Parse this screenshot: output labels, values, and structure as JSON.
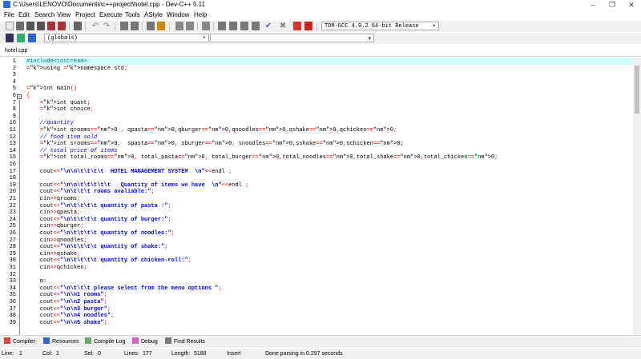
{
  "window": {
    "title": "C:\\Users\\LENOVO\\Documents\\c++project\\hotel.cpp - Dev-C++ 5.11",
    "minimize": "–",
    "maximize": "❐",
    "close": "✕"
  },
  "menu": [
    "File",
    "Edit",
    "Search",
    "View",
    "Project",
    "Execute",
    "Tools",
    "AStyle",
    "Window",
    "Help"
  ],
  "toolbar": {
    "compiler_select": "TDM-GCC 4.9.2 64-bit Release",
    "scope_select": "(globals)",
    "symbol_select": ""
  },
  "editor": {
    "file_tab": "hotel.cpp",
    "line_numbers": [
      "1",
      "2",
      "3",
      "4",
      "5",
      "6",
      "7",
      "8",
      "9",
      "10",
      "11",
      "12",
      "13",
      "14",
      "15",
      "16",
      "17",
      "18",
      "19",
      "20",
      "21",
      "22",
      "23",
      "24",
      "25",
      "26",
      "27",
      "28",
      "29",
      "30",
      "31",
      "32",
      "33",
      "34",
      "35",
      "36",
      "37",
      "38",
      "39"
    ],
    "lines": [
      "#include<iostream>",
      "using namespace std;",
      "",
      "",
      "int main()",
      "{",
      "    int quant;",
      "    int choice;",
      "",
      "    //quantity",
      "    int qrooms=0 , qpasta=0,qburger=0,qnoodles=0,qshake=0,qchicken=0;",
      "    // food item sold",
      "    int srooms=0,  spasta=0, sburger=0, snoodles=0,sshake=0,schicken=0;",
      "    // total price of items",
      "    int total_rooms=0, total_pasta=0, total_burger=0,total_noodles=0,total_shake=0,total_chicken=0;",
      "",
      "    cout<<\"\\n\\n\\t\\t\\t\\t  HOTEL MANAGEMENT SYSTEM  \\n\"<<endl ;",
      "",
      "    cout<<\"\\n\\n\\t\\t\\t\\t\\t   Quantity of items we have  \\n\"<<endl ;",
      "    cout<<\"\\n\\t\\t\\t rooms avaliable:\";",
      "    cin>>qrooms;",
      "    cout<<\"\\n\\t\\t\\t\\t quantity of pasta :\";",
      "    cin>>qpasta;",
      "    cout<<\"\\n\\t\\t\\t\\t quantity of burger:\";",
      "    cin>>qburger;",
      "    cout<<\"\\n\\t\\t\\t\\t quantity of noodles:\";",
      "    cin>>qnoodles;",
      "    cout<<\"\\n\\t\\t\\t\\t quantity of shake:\";",
      "    cin>>qshake;",
      "    cout<<\"\\n\\t\\t\\t\\t quantity of chicken-roll:\";",
      "    cin>>qchicken;",
      "",
      "    m:",
      "    cout<<\"\\n\\t\\t\\t please select from the menu options \";",
      "    cout<<\"\\n\\n1 rooms\";",
      "    cout<<\"\\n\\n2 pasta\";",
      "    cout<<\"\\n\\n3 burger\";",
      "    cout<<\"\\n\\n4 noodles\";",
      "    cout<<\"\\n\\n5 shake\";"
    ]
  },
  "bottom_tabs": [
    "Compiler",
    "Resources",
    "Compile Log",
    "Debug",
    "Find Results"
  ],
  "status": {
    "line_label": "Line:",
    "line_value": "1",
    "col_label": "Col:",
    "col_value": "1",
    "sel_label": "Sel:",
    "sel_value": "0",
    "lines_label": "Lines:",
    "lines_value": "177",
    "length_label": "Length:",
    "length_value": "5188",
    "mode": "Insert",
    "message": "Done parsing in 0.297 seconds"
  }
}
